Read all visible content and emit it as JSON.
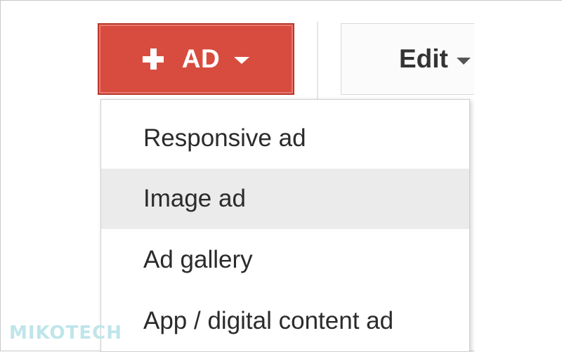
{
  "toolbar": {
    "add_label": "AD",
    "edit_label": "Edit",
    "accent_color": "#d84c3f"
  },
  "dropdown": {
    "items": [
      {
        "label": "Responsive ad"
      },
      {
        "label": "Image ad",
        "highlighted": true
      },
      {
        "label": "Ad gallery"
      },
      {
        "label": "App / digital content ad"
      }
    ]
  },
  "watermark": "MIKOTECH"
}
